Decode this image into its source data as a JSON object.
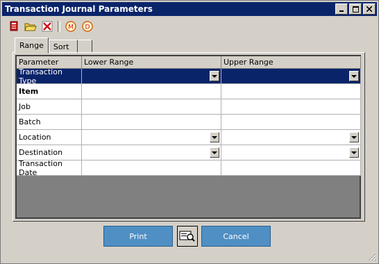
{
  "window": {
    "title": "Transaction Journal Parameters",
    "minimize_label": "_",
    "maximize_label": "□",
    "close_label": "×"
  },
  "toolbar": {
    "icons": [
      "report-icon",
      "open-folder-icon",
      "delete-icon",
      "m-icon",
      "d-icon"
    ],
    "m_label": "M",
    "d_label": "D"
  },
  "tabs": [
    {
      "label": "Range",
      "active": true
    },
    {
      "label": "Sort",
      "active": false
    }
  ],
  "grid": {
    "headers": [
      "Parameter",
      "Lower Range",
      "Upper Range"
    ],
    "rows": [
      {
        "parameter": "Transaction Type",
        "dropdown": true,
        "selected": true,
        "bold": false
      },
      {
        "parameter": "Item",
        "dropdown": false,
        "selected": false,
        "bold": true
      },
      {
        "parameter": "Job",
        "dropdown": false,
        "selected": false,
        "bold": false
      },
      {
        "parameter": "Batch",
        "dropdown": false,
        "selected": false,
        "bold": false
      },
      {
        "parameter": "Location",
        "dropdown": true,
        "selected": false,
        "bold": false
      },
      {
        "parameter": "Destination",
        "dropdown": true,
        "selected": false,
        "bold": false
      },
      {
        "parameter": "Transaction Date",
        "dropdown": false,
        "selected": false,
        "bold": false
      }
    ]
  },
  "buttons": {
    "print_label": "Print",
    "cancel_label": "Cancel"
  },
  "colors": {
    "titlebar": "#0a246a",
    "button": "#4f8fc4",
    "selection": "#0a246a"
  }
}
